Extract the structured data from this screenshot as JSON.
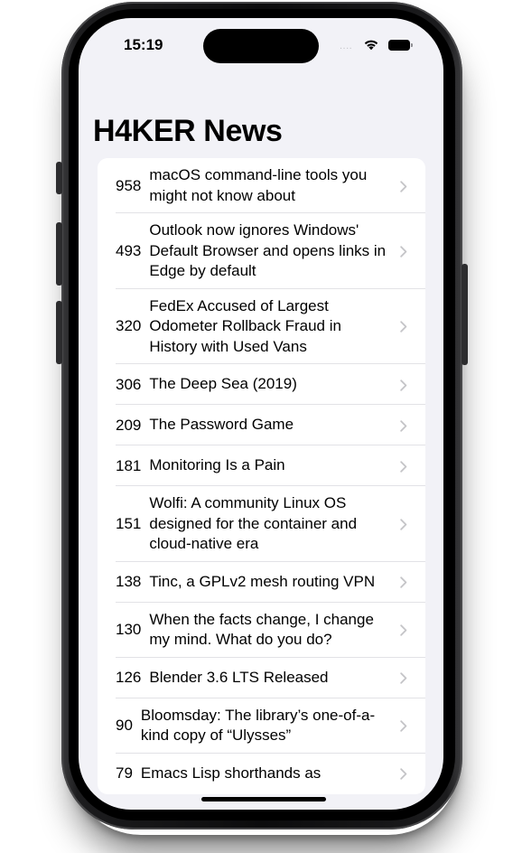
{
  "status_bar": {
    "time": "15:19",
    "signal": "....",
    "icons": [
      "wifi-icon",
      "battery-icon"
    ]
  },
  "app": {
    "title": "H4KER News"
  },
  "stories": [
    {
      "score": "958",
      "title": "macOS command-line tools you might not know about"
    },
    {
      "score": "493",
      "title": "Outlook now ignores Windows' Default Browser and opens links in Edge by default"
    },
    {
      "score": "320",
      "title": "FedEx Accused of Largest Odometer Rollback Fraud in History with Used Vans"
    },
    {
      "score": "306",
      "title": "The Deep Sea (2019)"
    },
    {
      "score": "209",
      "title": "The Password Game"
    },
    {
      "score": "181",
      "title": "Monitoring Is a Pain"
    },
    {
      "score": "151",
      "title": "Wolfi: A community Linux OS designed for the container and cloud-native era"
    },
    {
      "score": "138",
      "title": "Tinc, a GPLv2 mesh routing VPN"
    },
    {
      "score": "130",
      "title": "When the facts change, I change my mind. What do you do?"
    },
    {
      "score": "126",
      "title": "Blender 3.6 LTS Released"
    },
    {
      "score": "90",
      "title": "Bloomsday: The library’s one-of-a-kind copy of “Ulysses”"
    },
    {
      "score": "79",
      "title": "Emacs Lisp shorthands as"
    }
  ],
  "colors": {
    "background": "#f2f2f7",
    "card": "#ffffff",
    "chevron": "#c4c4c7",
    "separator": "#e2e2e6"
  }
}
